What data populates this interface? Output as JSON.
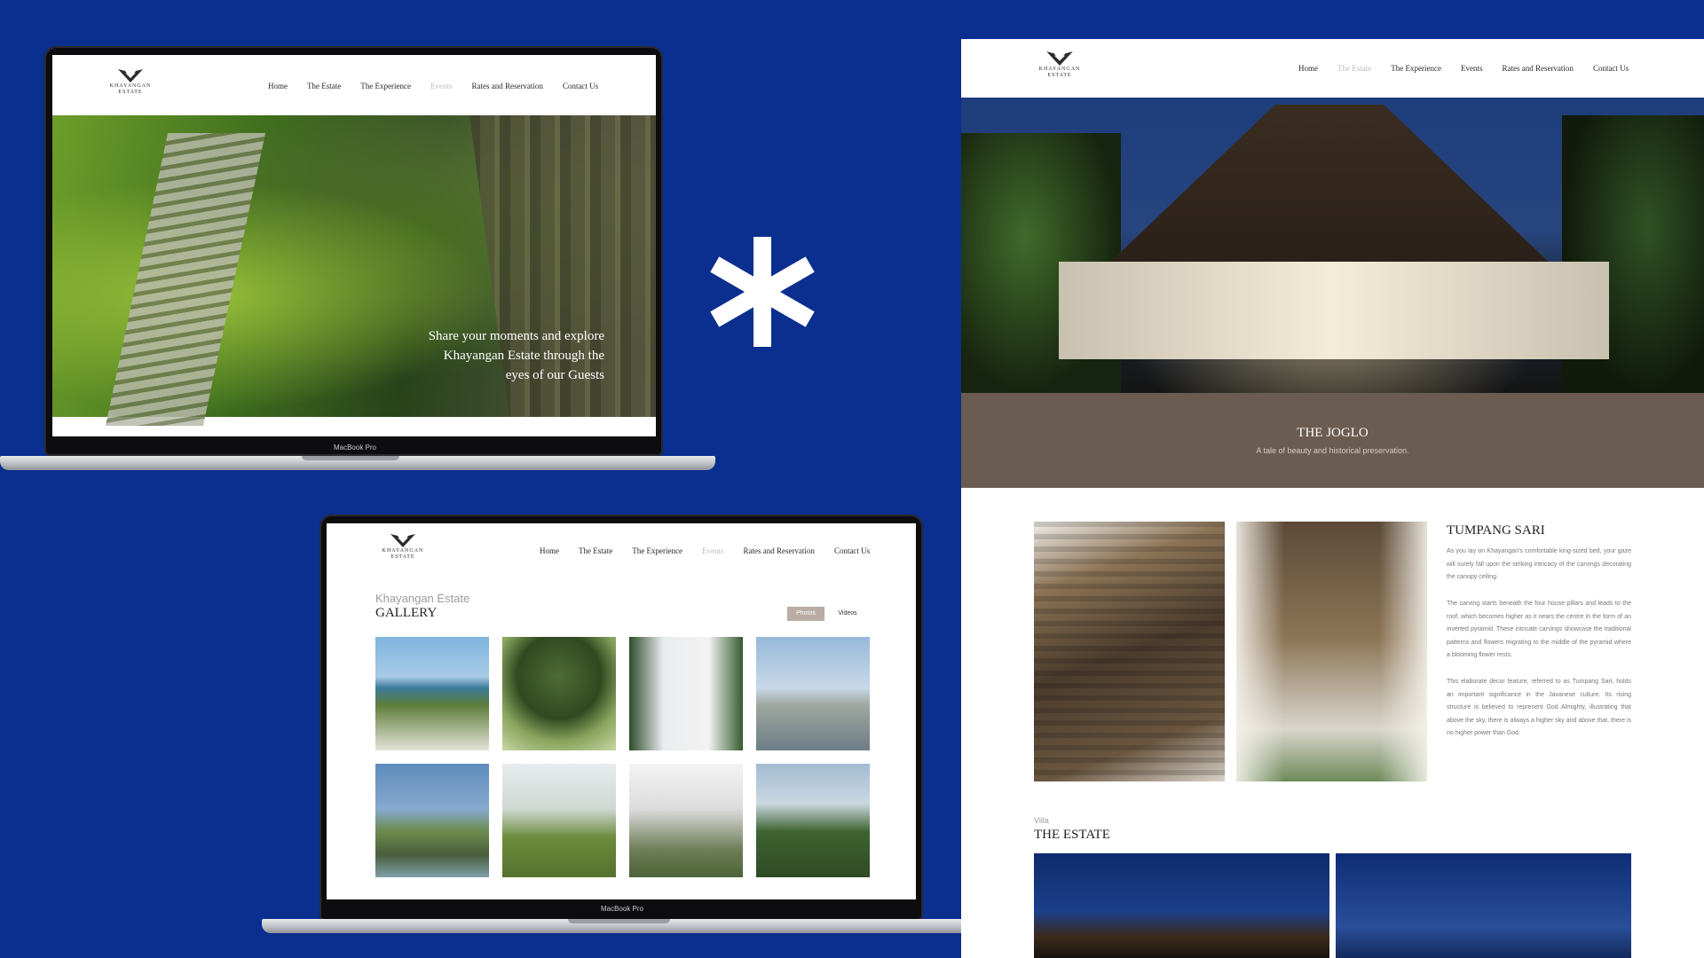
{
  "brand": {
    "wordmark_line1": "KHAYANGAN",
    "wordmark_line2": "ESTATE"
  },
  "nav": {
    "items": [
      "Home",
      "The Estate",
      "The Experience",
      "Events",
      "Rates and Reservation",
      "Contact Us"
    ]
  },
  "laptop1": {
    "active_item": "Events",
    "hero_caption": [
      "Share your moments and explore",
      "Khayangan Estate through the",
      "eyes of our Guests"
    ],
    "model": "MacBook Pro"
  },
  "laptop2": {
    "active_item": "Events",
    "subtitle": "Khayangan Estate",
    "title": "GALLERY",
    "tabs": [
      "Photos",
      "Videos"
    ],
    "active_tab": "Photos",
    "thumbnails": 8,
    "model": "MacBook Pro"
  },
  "page": {
    "active_item": "The Estate",
    "band_title": "THE JOGLO",
    "band_subtitle": "A tale of beauty and historical preservation.",
    "section_title": "TUMPANG SARI",
    "paragraphs": [
      "As you lay on Khayangan's comfortable king-sized bed, your gaze will surely fall upon the striking intricacy of the carvings decorating the canopy ceiling.",
      "The carving starts beneath the four house pillars and leads to the roof, which becomes higher as it nears the centre in the form of an inverted pyramid. These intricate carvings showcase the traditional patterns and flowers migrating to the middle of the pyramid where a blooming flower rests.",
      "This elaborate decor feature, referred to as Tumpang Sari, holds an important significance in the Javanese culture. Its rising structure is believed to represent God Almighty, illustrating that above the sky, there is always a higher sky and above that, there is no higher power than God."
    ],
    "villa_label": "Villa",
    "estate_title": "THE ESTATE"
  },
  "colors": {
    "background": "#0b2f8f",
    "band": "#6b5c51",
    "accent_tab": "#b8aca4",
    "inactive_nav": "#bdbdbd"
  }
}
